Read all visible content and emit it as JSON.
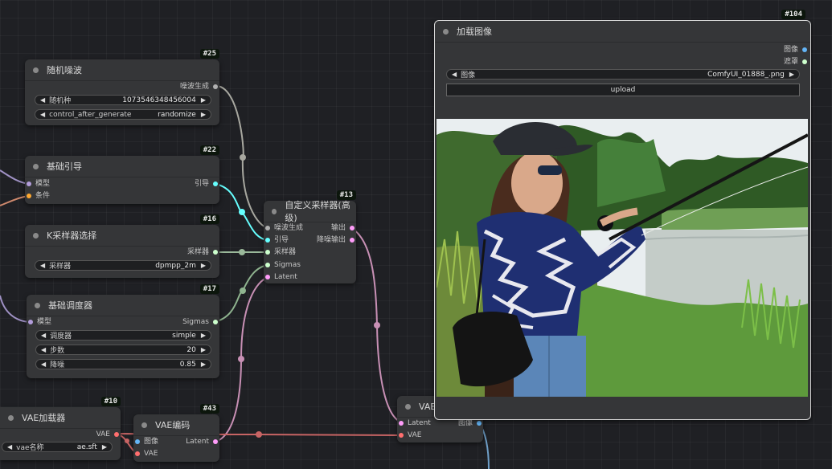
{
  "nodes": {
    "noise": {
      "id": "#25",
      "title": "随机噪波",
      "output": "噪波生成",
      "w_seed_label": "随机种",
      "w_seed_value": "1073546348456004",
      "w_cag_label": "control_after_generate",
      "w_cag_value": "randomize"
    },
    "guide": {
      "id": "#22",
      "title": "基础引导",
      "in_model": "模型",
      "in_cond": "条件",
      "output": "引导"
    },
    "ksel": {
      "id": "#16",
      "title": "K采样器选择",
      "output": "采样器",
      "w_label": "采样器",
      "w_value": "dpmpp_2m"
    },
    "sched": {
      "id": "#17",
      "title": "基础调度器",
      "in_model": "模型",
      "output": "Sigmas",
      "w1_label": "调度器",
      "w1_value": "simple",
      "w2_label": "步数",
      "w2_value": "20",
      "w3_label": "降噪",
      "w3_value": "0.85"
    },
    "custom": {
      "id": "#13",
      "title": "自定义采样器(高级)",
      "in1": "噪波生成",
      "in2": "引导",
      "in3": "采样器",
      "in4": "Sigmas",
      "in5": "Latent",
      "out1": "输出",
      "out2": "降噪输出"
    },
    "vaeload": {
      "id": "#10",
      "title": "VAE加载器",
      "output": "VAE",
      "w_label": "vae名称",
      "w_value": "ae.sft"
    },
    "vaeenc": {
      "id": "#43",
      "title": "VAE编码",
      "in1": "图像",
      "in2": "VAE",
      "output": "Latent"
    },
    "vaedec": {
      "title": "VAE解",
      "in1": "Latent",
      "in2": "VAE",
      "output": "图像"
    },
    "loadimg": {
      "id": "#104",
      "title": "加载图像",
      "out1": "图像",
      "out2": "遮罩",
      "w_label": "图像",
      "w_value": "ComfyUI_01888_.png",
      "upload": "upload"
    }
  },
  "colors": {
    "latent": "#ff9cf9",
    "vae": "#ff6e6e",
    "image": "#64b5f6",
    "noise": "#b0b0b0",
    "guider": "#66ffff",
    "sampler": "#ecb4b4",
    "sigmas": "#cdffcd",
    "model": "#b39ddb",
    "cond": "#ffa931"
  }
}
